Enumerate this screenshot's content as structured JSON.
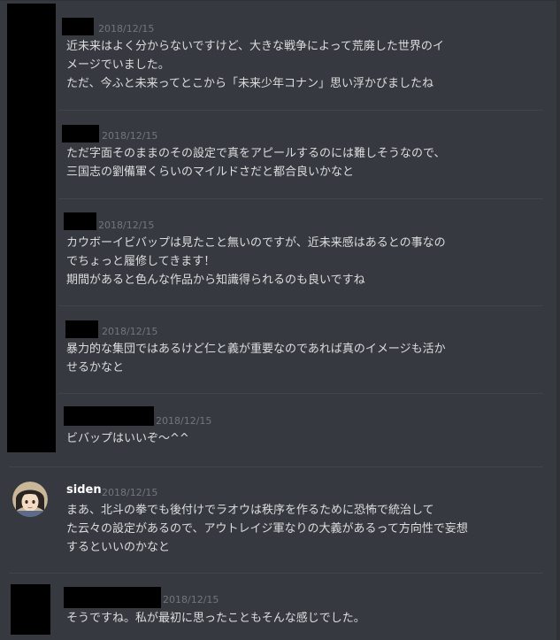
{
  "colors": {
    "background": "#36393f",
    "text": "#dcddde",
    "timestamp": "#72767d",
    "username": "#ffffff",
    "divider": "#40444b",
    "redaction": "#000000"
  },
  "messages": [
    {
      "timestamp": "2018/12/15",
      "lines": [
        "近未来はよく分からないですけど、大きな戦争によって荒廃した世界のイ",
        "メージでいました。",
        "ただ、今ふと未来ってとこから「未来少年コナン」思い浮かびましたね"
      ]
    },
    {
      "timestamp": "2018/12/15",
      "lines": [
        "ただ字面そのままのその設定で真をアピールするのには難しそうなので、",
        "三国志の劉備軍くらいのマイルドさだと都合良いかなと"
      ]
    },
    {
      "timestamp": "2018/12/15",
      "lines": [
        "カウボーイビバップは見たこと無いのですが、近未来感はあるとの事なの",
        "でちょっと履修してきます！",
        "期間があると色んな作品から知識得られるのも良いですね"
      ]
    },
    {
      "timestamp": "2018/12/15",
      "lines": [
        "暴力的な集団ではあるけど仁と義が重要なのであれば真のイメージも活か",
        "せるかなと"
      ]
    },
    {
      "timestamp": "2018/12/15",
      "lines": [
        "ビバップはいいぞ～^^"
      ]
    },
    {
      "username": "siden",
      "avatar_icon": "anime-character-avatar",
      "timestamp": "2018/12/15",
      "lines": [
        "まあ、北斗の拳でも後付けでラオウは秩序を作るために恐怖で統治して",
        "た云々の設定があるので、アウトレイジ軍なりの大義があるって方向性で妄想",
        "するといいのかなと"
      ]
    },
    {
      "timestamp": "2018/12/15",
      "lines": [
        "そうですね。私が最初に思ったこともそんな感じでした。"
      ]
    }
  ]
}
